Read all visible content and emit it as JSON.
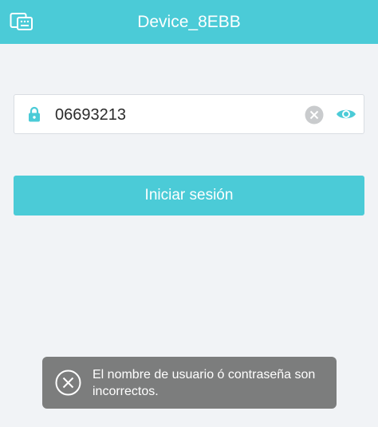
{
  "header": {
    "title": "Device_8EBB",
    "icon": "device-icon",
    "color": "#4bcbd7"
  },
  "login": {
    "password_value": "06693213",
    "lock_icon": "lock-icon",
    "clear_icon": "clear-icon",
    "visibility_icon": "eye-icon",
    "button_label": "Iniciar sesión"
  },
  "toast": {
    "icon": "error-icon",
    "message": "El nombre de usuario ó contraseña son incorrectos."
  }
}
